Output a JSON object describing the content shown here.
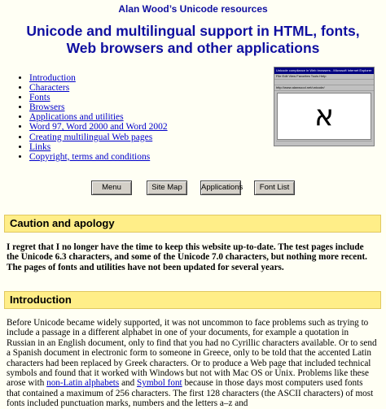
{
  "header": {
    "site_title": "Alan Wood’s Unicode resources",
    "main_title": "Unicode and multilingual support in HTML, fonts, Web browsers and other applications"
  },
  "toc": {
    "items": [
      {
        "label": "Introduction"
      },
      {
        "label": "Characters"
      },
      {
        "label": "Fonts"
      },
      {
        "label": "Browsers"
      },
      {
        "label": "Applications and utilities"
      },
      {
        "label": "Word 97, Word 2000 and Word 2002"
      },
      {
        "label": "Creating multilingual Web pages"
      },
      {
        "label": "Links"
      },
      {
        "label": "Copyright, terms and conditions"
      }
    ]
  },
  "screenshot": {
    "title": "Unicode compliance in Web browsers - Microsoft Internet Explorer",
    "menu": "File  Edit  View  Favorites  Tools  Help",
    "address": "http://www.alanwood.net/unicode/",
    "glyph": "א"
  },
  "nav": {
    "menu": "Menu",
    "site_map": "Site Map",
    "applications": "Applications",
    "font_list": "Font List"
  },
  "caution": {
    "heading": "Caution and apology",
    "text": "I regret that I no longer have the time to keep this website up-to-date. The test pages include the Unicode 6.3 characters, and some of the Unicode 7.0 characters, but nothing more recent. The pages of fonts and utilities have not been updated for several years."
  },
  "intro": {
    "heading": "Introduction",
    "text_1": "Before Unicode became widely supported, it was not uncommon to face problems such as trying to include a passage in a different alphabet in one of your documents, for example a quotation in Russian in an English document, only to find that you had no Cyrillic characters available. Or to send a Spanish document in electronic form to someone in Greece, only to be told that the accented Latin characters had been replaced by Greek characters. Or to produce a Web page that included technical symbols and found that it worked with Windows but not with Mac OS or Unix. Problems like these arose with",
    "link_1": "non-Latin alphabets",
    "and": " and ",
    "link_2": "Symbol font",
    "text_2": "because in those days most computers used fonts that contained a maximum of 256 characters. The first 128 characters (the ASCII characters) of most fonts included punctuation marks, numbers and the letters a–z and"
  }
}
